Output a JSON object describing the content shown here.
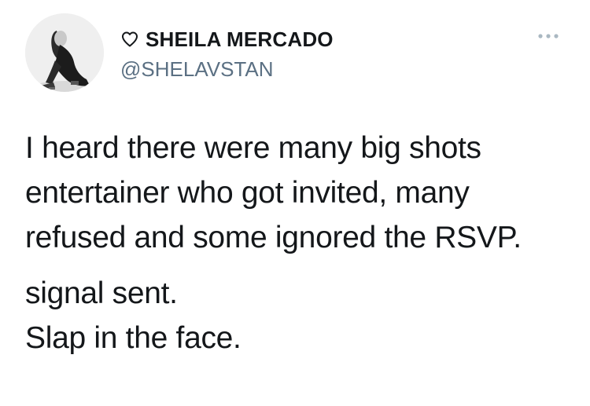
{
  "user": {
    "display_name": "SHEILA MERCADO",
    "handle": "@SHELAVSTAN",
    "badge_icon": "heart-outline-icon",
    "avatar_icon": "profile-photo"
  },
  "menu_icon": "more-options-icon",
  "tweet": {
    "lines_para1": [
      "I heard there were many big shots",
      "entertainer who got invited, many",
      "refused and some ignored the RSVP."
    ],
    "lines_para2": [
      "signal sent.",
      "Slap in the face."
    ]
  },
  "colors": {
    "text": "#14171a",
    "secondary": "#5b7083",
    "background": "#ffffff"
  }
}
